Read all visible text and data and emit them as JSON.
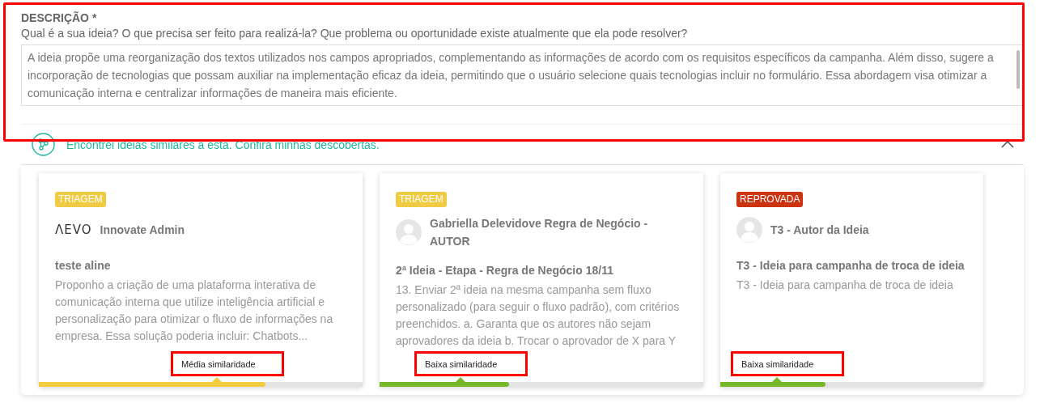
{
  "description": {
    "label": "DESCRIÇÃO *",
    "question": "Qual é a sua ideia? O que precisa ser feito para realizá-la? Que problema ou oportunidade existe atualmente que ela pode resolver?",
    "value": "A ideia propõe uma reorganização dos textos utilizados nos campos apropriados, complementando as informações de acordo com os requisitos específicos da campanha. Além disso, sugere a incorporação de tecnologias que possam auxiliar na implementação eficaz da ideia, permitindo que o usuário selecione quais tecnologias incluir no formulário. Essa abordagem visa otimizar a comunicação interna e centralizar informações de maneira mais eficiente.",
    "highlighted": true
  },
  "similar": {
    "message": "Encontrei ideias similares a esta. Confira minhas descobertas.",
    "expanded": true,
    "cards": [
      {
        "status": {
          "label": "TRIAGEM",
          "color": "#f0cc45"
        },
        "kind": "logo",
        "logo_text": "ΛEVO",
        "author": "Innovate Admin",
        "title": "teste aline",
        "summary": "Proponho a criação de uma plataforma interativa de comunicação interna que utilize inteligência artificial e personalização para otimizar o fluxo de informações na empresa. Essa solução poderia incluir: Chatbots...",
        "similarity": "Média similaridade",
        "level": 0.7,
        "color": "#f2cd41",
        "highlighted": true
      },
      {
        "status": {
          "label": "TRIAGEM",
          "color": "#f0cc45"
        },
        "kind": "avatar",
        "author": "Gabriella Delevidove Regra de Negócio - AUTOR",
        "title": "2ª Ideia - Etapa - Regra de Negócio 18/11",
        "summary": "13. Enviar 2ª ideia na mesma campanha sem fluxo personalizado (para seguir o fluxo padrão), com critérios preenchidos. a. Garanta que os autores não sejam aprovadores da ideia b. Trocar o aprovador de X para Y",
        "similarity": "Baixa similaridade",
        "level": 0.4,
        "color": "#76b82a",
        "highlighted": true
      },
      {
        "status": {
          "label": "REPROVADA",
          "color": "#cc3311"
        },
        "kind": "avatar",
        "author": "T3 - Autor da Ideia",
        "title": "T3 - Ideia para campanha de troca de ideia",
        "summary": "T3 - Ideia para campanha de troca de ideia",
        "similarity": "Baixa similaridade",
        "level": 0.4,
        "color": "#76b82a",
        "highlighted": true
      }
    ]
  }
}
